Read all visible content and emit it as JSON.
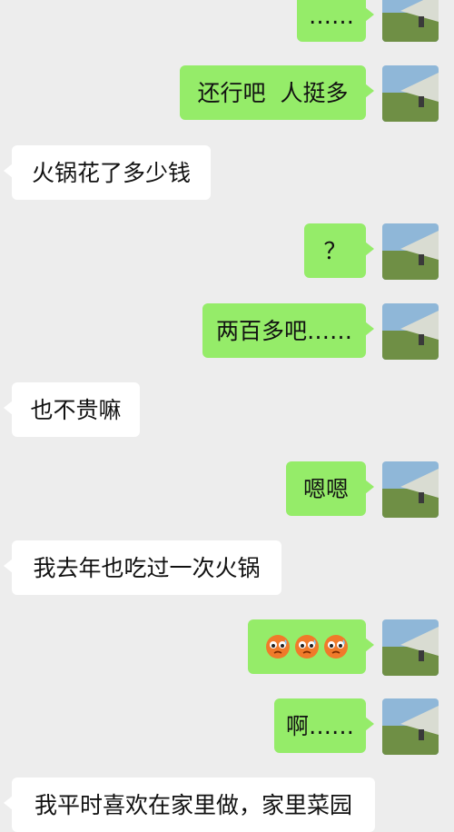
{
  "messages": [
    {
      "side": "out",
      "text": "……"
    },
    {
      "side": "out",
      "text": "还行吧  人挺多"
    },
    {
      "side": "in",
      "text": "火锅花了多少钱"
    },
    {
      "side": "out",
      "text": "？"
    },
    {
      "side": "out",
      "text": "两百多吧……"
    },
    {
      "side": "in",
      "text": "也不贵嘛"
    },
    {
      "side": "out",
      "text": "嗯嗯"
    },
    {
      "side": "in",
      "text": "我去年也吃过一次火锅"
    },
    {
      "side": "out",
      "emoji": [
        "worried-face-emoji",
        "worried-face-emoji",
        "worried-face-emoji"
      ]
    },
    {
      "side": "out",
      "text": "啊……"
    },
    {
      "side": "in",
      "text": "我平时喜欢在家里做，家里菜园"
    }
  ],
  "colors": {
    "background": "#ededed",
    "outgoing_bubble": "#95ec69",
    "incoming_bubble": "#ffffff"
  }
}
